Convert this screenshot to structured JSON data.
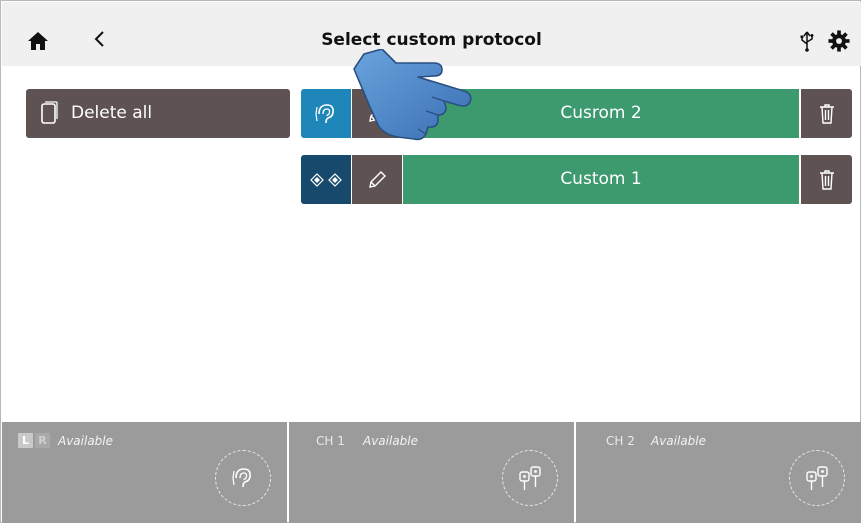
{
  "header": {
    "title": "Select custom protocol",
    "icons": [
      "home-icon",
      "back-icon",
      "usb-icon",
      "gear-icon"
    ]
  },
  "actions": {
    "delete_all_label": "Delete all"
  },
  "protocols": [
    {
      "name": "Cusrom 2",
      "type_icon": "ear-icon",
      "type_color": "#1e86b8"
    },
    {
      "name": "Custom 1",
      "type_icon": "binaural-icon",
      "type_color": "#16496b"
    }
  ],
  "footer": {
    "panels": [
      {
        "tag_left": "L",
        "tag_right": "R",
        "status": "Available",
        "icon": "ear-icon"
      },
      {
        "tag": "CH 1",
        "status": "Available",
        "icon": "transducer-icon"
      },
      {
        "tag": "CH 2",
        "status": "Available",
        "icon": "transducer-icon"
      }
    ]
  },
  "colors": {
    "header_bg": "#f0f0f0",
    "dark_button": "#5e5252",
    "protocol_green": "#3d9a6e",
    "footer_panel": "#9b9b9b"
  }
}
